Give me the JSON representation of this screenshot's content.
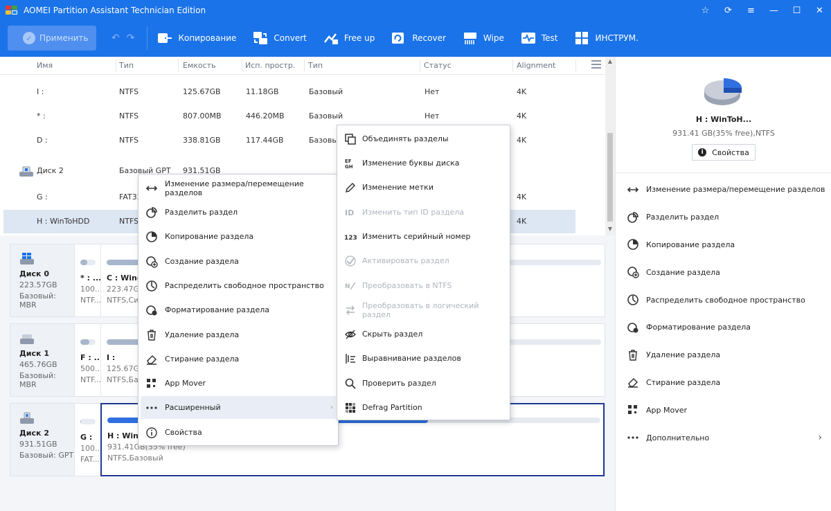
{
  "app": {
    "title": "AOMEI Partition Assistant Technician Edition",
    "window_buttons": [
      "☆",
      "⟳",
      "≡",
      "—",
      "☐",
      "✕"
    ]
  },
  "toolbar": {
    "apply_label": "Применить",
    "items": [
      "Копирование",
      "Convert",
      "Free up",
      "Recover",
      "Wipe",
      "Test",
      "ИНСТРУМ."
    ]
  },
  "table": {
    "headers": [
      "Имя",
      "Тип",
      "Емкость",
      "Исп. простр.",
      "Тип",
      "Статус",
      "Alignment"
    ],
    "rows": [
      {
        "name": "I :",
        "fs": "NTFS",
        "capacity": "125.67GB",
        "used": "11.18GB",
        "type": "Базовый",
        "status": "Нет",
        "align": "4K"
      },
      {
        "name": "* :",
        "fs": "NTFS",
        "capacity": "807.00MB",
        "used": "446.20MB",
        "type": "Базовый",
        "status": "Нет",
        "align": "4K"
      },
      {
        "name": "D :",
        "fs": "NTFS",
        "capacity": "338.81GB",
        "used": "117.44GB",
        "type": "Базовы",
        "status": "",
        "align": "4K"
      },
      {
        "name": "Диск 2",
        "fs": "Базовый GPT",
        "capacity": "931.51GB",
        "used": "",
        "type": "",
        "status": "",
        "align": ""
      },
      {
        "name": "G :",
        "fs": "FAT32",
        "capacity": "",
        "used": "",
        "type": "",
        "status": "",
        "align": "4K"
      },
      {
        "name": "H : WinToHDD",
        "fs": "NTFS",
        "capacity": "",
        "used": "",
        "type": "",
        "status": "",
        "align": "4K"
      }
    ]
  },
  "disks": [
    {
      "name": "Диск 0",
      "size": "223.57GB",
      "type": "Базовый: MBR",
      "parts": [
        {
          "label": "* : ...",
          "sub1": "100....",
          "sub2": "NTF...",
          "used": 0.45
        },
        {
          "label": "C : Windo",
          "sub1": "223.47GB",
          "sub2": "NTFS,Сис",
          "used": 0.8
        }
      ]
    },
    {
      "name": "Диск 1",
      "size": "465.76GB",
      "type": "Базовый: MBR",
      "parts": [
        {
          "label": "F : ...",
          "sub1": "500....",
          "sub2": "NTF...",
          "used": 0.6
        },
        {
          "label": "I :",
          "sub1": "125.67GB",
          "sub2": "NTFS,Ба",
          "used": 0.15
        }
      ]
    },
    {
      "name": "Диск 2",
      "size": "931.51GB",
      "type": "Базовый: GPT",
      "parts": [
        {
          "label": "G :",
          "sub1": "100....",
          "sub2": "FAT...",
          "used": 0.05
        },
        {
          "label": "H : WinTo",
          "sub1": "931.41GB(35% free)",
          "sub2": "NTFS,Базовый",
          "used": 0.65
        }
      ]
    }
  ],
  "right_panel": {
    "title": "H : WinToH...",
    "subtitle": "931.41 GB(35% free),NTFS",
    "properties_label": "Свойства",
    "items": [
      "Изменение размера/перемещение разделов",
      "Разделить раздел",
      "Копирование раздела",
      "Создание раздела",
      "Распределить свободное пространство",
      "Форматирование раздела",
      "Удаление раздела",
      "Стирание раздела",
      "App Mover",
      "Дополнительно"
    ]
  },
  "context_menu": {
    "items": [
      "Изменение размера/перемещение разделов",
      "Разделить раздел",
      "Копирование раздела",
      "Создание раздела",
      "Распределить свободное пространство",
      "Форматирование раздела",
      "Удаление раздела",
      "Стирание раздела",
      "App Mover",
      "Расширенный",
      "Свойства"
    ]
  },
  "submenu": {
    "items": [
      {
        "label": "Объединять разделы",
        "enabled": true
      },
      {
        "label": "Изменение буквы диска",
        "enabled": true
      },
      {
        "label": "Изменение метки",
        "enabled": true
      },
      {
        "label": "Изменить тип ID раздела",
        "enabled": false
      },
      {
        "label": "Изменить серийный номер",
        "enabled": true
      },
      {
        "label": "Активировать раздел",
        "enabled": false
      },
      {
        "label": "Преобразовать в NTFS",
        "enabled": false
      },
      {
        "label": "Преобразовать в логический раздел",
        "enabled": false
      },
      {
        "label": "Скрыть раздел",
        "enabled": true
      },
      {
        "label": "Выравнивание разделов",
        "enabled": true
      },
      {
        "label": "Проверить раздел",
        "enabled": true
      },
      {
        "label": "Defrag Partition",
        "enabled": true
      }
    ]
  },
  "colors": {
    "accent": "#1a73e8",
    "selected_row": "#dde6f3",
    "pie_used": "#2f6fe0",
    "pie_free": "#c9ced8"
  }
}
